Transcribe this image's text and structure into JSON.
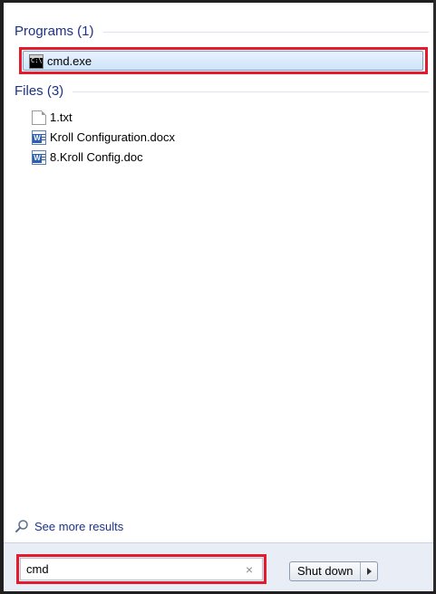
{
  "results": {
    "programs_header": "Programs (1)",
    "programs": [
      {
        "label": "cmd.exe",
        "icon": "command-prompt-icon",
        "icon_text": "C:\\"
      }
    ],
    "files_header": "Files (3)",
    "files": [
      {
        "label": "1.txt",
        "icon": "text-file-icon"
      },
      {
        "label": "Kroll Configuration.docx",
        "icon": "word-document-icon"
      },
      {
        "label": "8.Kroll Config.doc",
        "icon": "word-document-icon"
      }
    ],
    "see_more": "See more results"
  },
  "search": {
    "value": "cmd",
    "clear_glyph": "×"
  },
  "power": {
    "shutdown_label": "Shut down"
  },
  "colors": {
    "header_text": "#1e3287",
    "highlight_border": "#e41b2c",
    "selection_fill": "#cfe4fa"
  }
}
